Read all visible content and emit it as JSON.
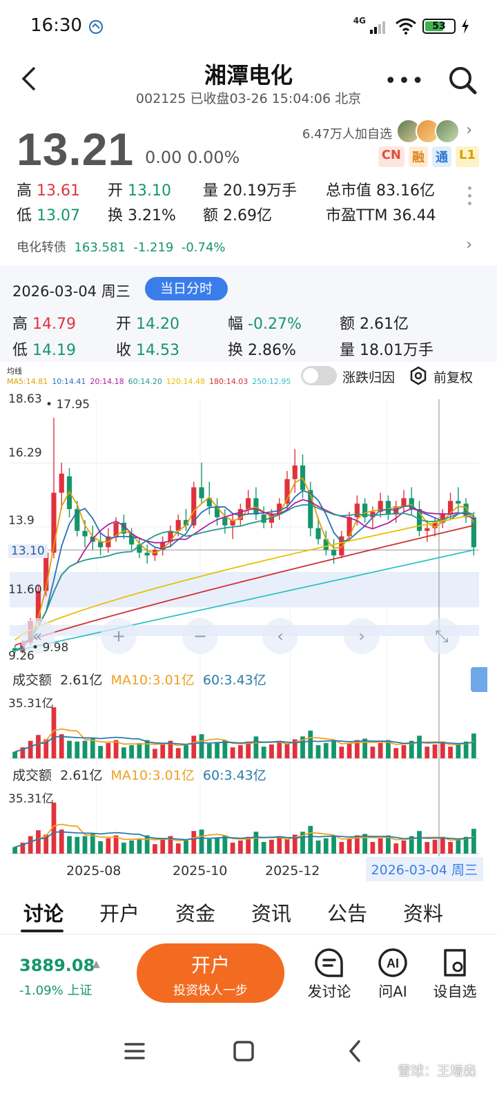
{
  "status_bar": {
    "time": "16:30",
    "network": "4G",
    "battery": "53"
  },
  "header": {
    "title": "湘潭电化",
    "subtitle": "002125 已收盘03-26 15:04:06 北京"
  },
  "quote": {
    "price": "13.21",
    "change": "0.00 0.00%",
    "followers": "6.47万人加自选",
    "badges": [
      "CN",
      "融",
      "通",
      "L1"
    ],
    "rows": [
      [
        {
          "label": "高",
          "value": "13.61",
          "color": "red"
        },
        {
          "label": "开",
          "value": "13.10",
          "color": "green"
        },
        {
          "label": "量",
          "value": "20.19万手",
          "color": "plain"
        },
        {
          "label": "总市值",
          "value": "83.16亿",
          "color": "plain"
        }
      ],
      [
        {
          "label": "低",
          "value": "13.07",
          "color": "green"
        },
        {
          "label": "换",
          "value": "3.21%",
          "color": "plain"
        },
        {
          "label": "额",
          "value": "2.69亿",
          "color": "plain"
        },
        {
          "label": "市盈TTM",
          "value": "36.44",
          "color": "plain"
        }
      ]
    ],
    "convertible": {
      "label": "电化转债",
      "value": "163.581",
      "change": "-1.219",
      "pct": "-0.74%"
    }
  },
  "day_panel": {
    "date": "2026-03-04 周三",
    "button": "当日分时",
    "rows": [
      [
        {
          "label": "高",
          "value": "14.79",
          "color": "red"
        },
        {
          "label": "开",
          "value": "14.20",
          "color": "green"
        },
        {
          "label": "幅",
          "value": "-0.27%",
          "color": "green"
        },
        {
          "label": "额",
          "value": "2.61亿",
          "color": "plain"
        }
      ],
      [
        {
          "label": "低",
          "value": "14.19",
          "color": "green"
        },
        {
          "label": "收",
          "value": "14.53",
          "color": "green"
        },
        {
          "label": "换",
          "value": "2.86%",
          "color": "plain"
        },
        {
          "label": "量",
          "value": "18.01万手",
          "color": "plain"
        }
      ]
    ]
  },
  "chart": {
    "ma_legend": [
      {
        "text": "均线",
        "color": "#222222"
      },
      {
        "text": "MA5:14.81",
        "color": "#e0a000"
      },
      {
        "text": "10:14.41",
        "color": "#2a6fb0"
      },
      {
        "text": "20:14.18",
        "color": "#b0209a"
      },
      {
        "text": "60:14.20",
        "color": "#1f9a8a"
      },
      {
        "text": "120:14.48",
        "color": "#e8c000"
      },
      {
        "text": "180:14.03",
        "color": "#d03030"
      },
      {
        "text": "250:12.95",
        "color": "#30c0c8"
      }
    ],
    "toggle_label": "涨跌归因",
    "fuquan_label": "前复权",
    "price_labels": [
      "18.63",
      "16.29",
      "13.9",
      "13.10",
      "11.60",
      "9.26"
    ],
    "max_marker": "17.95",
    "min_marker": "9.98",
    "volume_panels": [
      {
        "label": "成交额",
        "value": "2.61亿",
        "ma10": "MA10:3.01亿",
        "ma60": "60:3.43亿",
        "max": "35.31亿"
      },
      {
        "label": "成交额",
        "value": "2.61亿",
        "ma10": "MA10:3.01亿",
        "ma60": "60:3.43亿",
        "max": "35.31亿"
      }
    ],
    "date_ticks": [
      "2025-08",
      "2025-10",
      "2025-12"
    ],
    "selected_date": "2026-03-04 周三",
    "up_color": "#e0323c",
    "down_color": "#14966b"
  },
  "tabs": [
    "讨论",
    "开户",
    "资金",
    "资讯",
    "公告",
    "资料"
  ],
  "bottom_bar": {
    "index_value": "3889.08",
    "index_change": "-1.09% 上证",
    "open_button": "开户",
    "open_sub": "投资快人一步",
    "actions": [
      "发讨论",
      "问AI",
      "设自选"
    ]
  },
  "watermark": "雪球：王增森",
  "chart_data": {
    "type": "candlestick",
    "x_ticks": [
      "2025-08",
      "2025-10",
      "2025-12"
    ],
    "y_labels": [
      18.63,
      16.29,
      13.9,
      11.6,
      9.26
    ],
    "reference_price": 13.1,
    "high_marker": 17.95,
    "low_marker": 9.98,
    "ohlc_approx": [
      [
        9.5,
        9.6,
        9.3,
        9.4
      ],
      [
        9.4,
        9.8,
        9.3,
        9.7
      ],
      [
        9.7,
        10.6,
        9.6,
        10.5
      ],
      [
        10.5,
        11.8,
        10.4,
        11.6
      ],
      [
        11.6,
        13.2,
        11.4,
        13.0
      ],
      [
        13.0,
        17.95,
        12.8,
        15.2
      ],
      [
        15.2,
        16.3,
        14.6,
        15.9
      ],
      [
        15.8,
        16.1,
        14.3,
        14.6
      ],
      [
        14.6,
        14.9,
        13.6,
        13.8
      ],
      [
        13.8,
        14.2,
        13.2,
        13.6
      ],
      [
        13.6,
        14.0,
        13.1,
        13.4
      ],
      [
        13.4,
        13.8,
        12.9,
        13.2
      ],
      [
        13.2,
        13.9,
        13.0,
        13.6
      ],
      [
        13.6,
        14.3,
        13.4,
        14.1
      ],
      [
        14.1,
        14.4,
        13.5,
        13.7
      ],
      [
        13.7,
        13.9,
        13.1,
        13.3
      ],
      [
        13.3,
        13.5,
        12.8,
        13.0
      ],
      [
        13.0,
        13.3,
        12.6,
        12.9
      ],
      [
        12.9,
        13.2,
        12.7,
        13.1
      ],
      [
        13.1,
        13.6,
        12.9,
        13.4
      ],
      [
        13.4,
        14.0,
        13.2,
        13.8
      ],
      [
        13.8,
        14.4,
        13.6,
        14.2
      ],
      [
        14.2,
        14.6,
        13.8,
        14.0
      ],
      [
        14.0,
        15.6,
        13.9,
        15.4
      ],
      [
        15.4,
        16.3,
        14.8,
        15.0
      ],
      [
        15.0,
        15.6,
        14.4,
        14.7
      ],
      [
        14.7,
        15.0,
        14.0,
        14.3
      ],
      [
        14.3,
        14.6,
        13.7,
        14.0
      ],
      [
        14.0,
        14.4,
        13.5,
        14.2
      ],
      [
        14.2,
        14.8,
        14.0,
        14.6
      ],
      [
        14.6,
        15.3,
        14.4,
        15.0
      ],
      [
        15.0,
        15.4,
        14.2,
        14.4
      ],
      [
        14.4,
        14.7,
        13.9,
        14.1
      ],
      [
        14.1,
        14.6,
        13.9,
        14.4
      ],
      [
        14.4,
        15.0,
        14.2,
        14.8
      ],
      [
        14.8,
        16.0,
        14.6,
        15.7
      ],
      [
        15.7,
        16.8,
        15.2,
        16.2
      ],
      [
        16.2,
        16.6,
        15.0,
        15.3
      ],
      [
        15.3,
        15.6,
        13.6,
        13.9
      ],
      [
        13.9,
        14.3,
        13.3,
        13.5
      ],
      [
        13.5,
        13.8,
        12.9,
        13.1
      ],
      [
        13.1,
        13.5,
        12.6,
        12.9
      ],
      [
        12.9,
        13.8,
        12.8,
        13.6
      ],
      [
        13.6,
        14.5,
        13.5,
        14.3
      ],
      [
        14.3,
        15.1,
        14.0,
        14.8
      ],
      [
        14.8,
        15.0,
        14.1,
        14.3
      ],
      [
        14.3,
        14.7,
        13.9,
        14.5
      ],
      [
        14.5,
        15.2,
        14.3,
        14.9
      ],
      [
        14.9,
        15.1,
        14.2,
        14.4
      ],
      [
        14.4,
        14.9,
        14.1,
        14.7
      ],
      [
        14.7,
        15.3,
        14.5,
        15.0
      ],
      [
        15.0,
        15.4,
        14.4,
        14.6
      ],
      [
        14.6,
        14.9,
        13.6,
        13.8
      ],
      [
        13.8,
        14.2,
        13.4,
        13.9
      ],
      [
        13.9,
        14.3,
        13.6,
        14.1
      ],
      [
        14.1,
        14.6,
        13.9,
        14.4
      ],
      [
        14.4,
        15.2,
        14.2,
        14.9
      ],
      [
        14.9,
        15.4,
        14.5,
        14.8
      ],
      [
        14.8,
        15.0,
        14.1,
        14.3
      ],
      [
        14.3,
        14.5,
        12.9,
        13.2
      ]
    ]
  }
}
